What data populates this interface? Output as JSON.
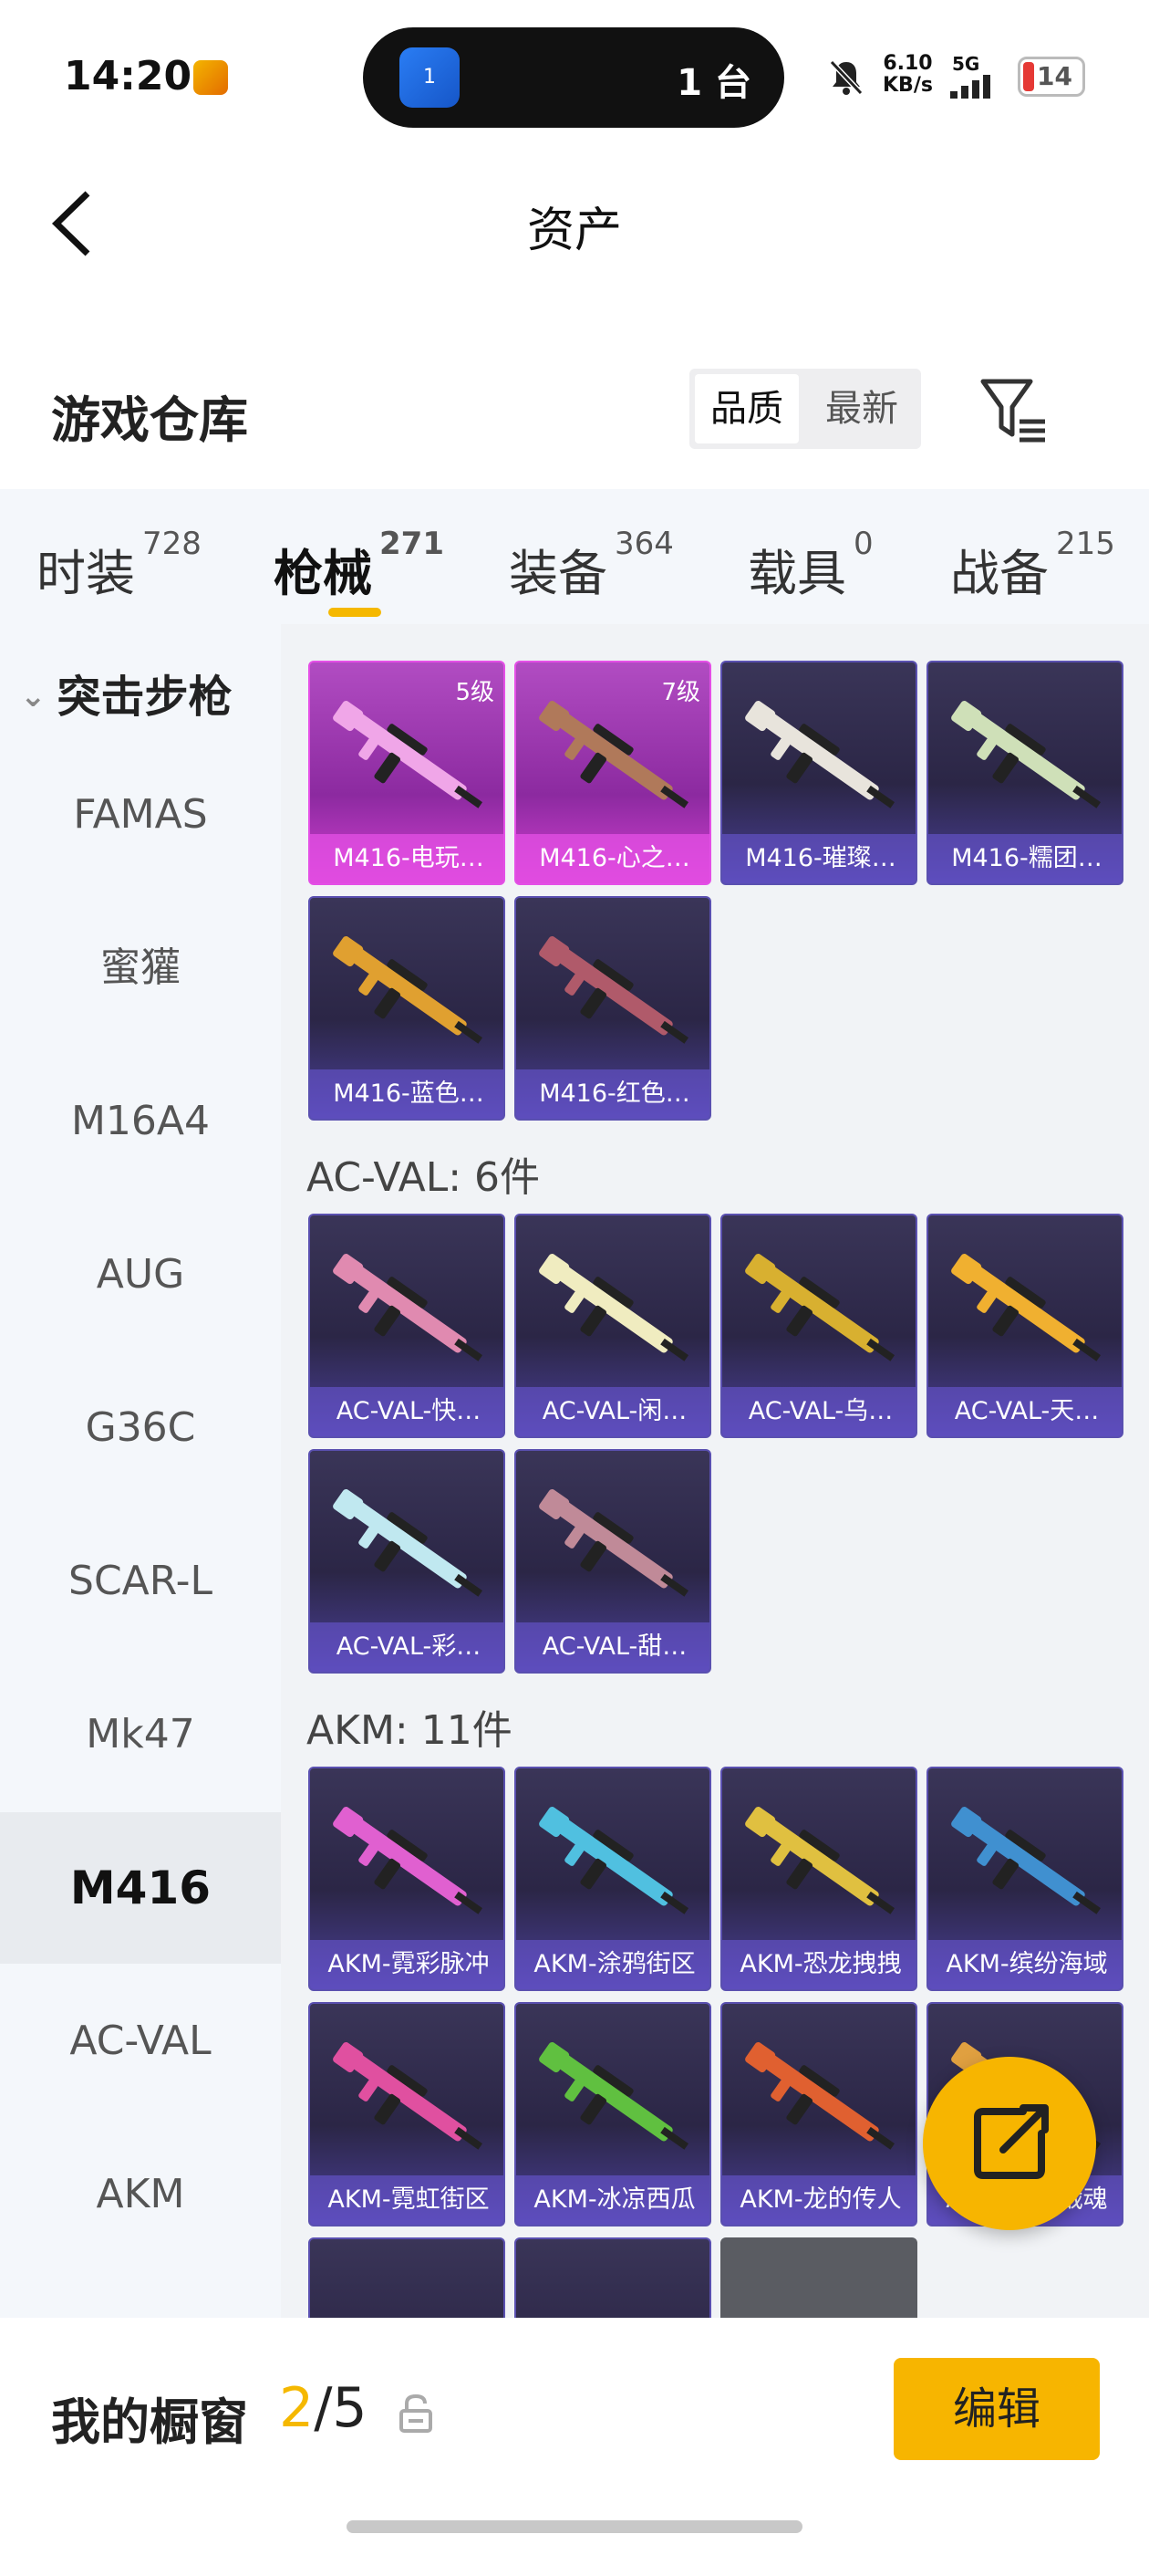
{
  "status_bar": {
    "time": "14:20",
    "island_badge": "1",
    "island_text": "1 台",
    "net_speed_value": "6.10",
    "net_speed_unit": "KB/s",
    "network_type": "5G",
    "battery": "14",
    "icons": [
      "app-icon",
      "broadcast-icon",
      "mute-icon",
      "signal-icon",
      "battery-icon"
    ]
  },
  "header": {
    "title": "资产",
    "back_icon": "chevron-left-icon"
  },
  "warehouse": {
    "title": "游戏仓库",
    "sort_options": [
      "品质",
      "最新"
    ],
    "sort_selected": "品质",
    "filter_icon": "filter-icon"
  },
  "tabs": [
    {
      "label": "时装",
      "count": "728"
    },
    {
      "label": "枪械",
      "count": "271",
      "active": true
    },
    {
      "label": "装备",
      "count": "364"
    },
    {
      "label": "载具",
      "count": "0"
    },
    {
      "label": "战备",
      "count": "215"
    }
  ],
  "sidebar": {
    "group": "突击步枪",
    "items": [
      "FAMAS",
      "蜜獾",
      "M16A4",
      "AUG",
      "G36C",
      "SCAR-L",
      "Mk47",
      "M416",
      "AC-VAL",
      "AKM"
    ],
    "selected": "M416"
  },
  "grid": {
    "groups": [
      {
        "heading": "",
        "cards": [
          {
            "name": "M416-电玩…",
            "level": "5级",
            "tier": "pink",
            "gun_color": "#f0a6e8"
          },
          {
            "name": "M416-心之…",
            "level": "7级",
            "tier": "pink",
            "gun_color": "#b0795a"
          },
          {
            "name": "M416-璀璨…",
            "level": "",
            "tier": "purple",
            "gun_color": "#e8e4dc"
          },
          {
            "name": "M416-糯团…",
            "level": "",
            "tier": "purple",
            "gun_color": "#cfe0b8"
          },
          {
            "name": "M416-蓝色…",
            "level": "",
            "tier": "purple",
            "gun_color": "#e0a030"
          },
          {
            "name": "M416-红色…",
            "level": "",
            "tier": "purple",
            "gun_color": "#b05a6a"
          }
        ]
      },
      {
        "heading": "AC-VAL: 6件",
        "cards": [
          {
            "name": "AC-VAL-快…",
            "level": "",
            "tier": "purple",
            "gun_color": "#e08ab0"
          },
          {
            "name": "AC-VAL-闲…",
            "level": "",
            "tier": "purple",
            "gun_color": "#f0ecc0"
          },
          {
            "name": "AC-VAL-乌…",
            "level": "",
            "tier": "purple",
            "gun_color": "#d8b030"
          },
          {
            "name": "AC-VAL-天…",
            "level": "",
            "tier": "purple",
            "gun_color": "#f0b030"
          },
          {
            "name": "AC-VAL-彩…",
            "level": "",
            "tier": "purple",
            "gun_color": "#c0e8f0"
          },
          {
            "name": "AC-VAL-甜…",
            "level": "",
            "tier": "purple",
            "gun_color": "#c08a98"
          }
        ]
      },
      {
        "heading": "AKM: 11件",
        "cards": [
          {
            "name": "AKM-霓彩脉冲",
            "level": "",
            "tier": "purple",
            "gun_color": "#e060d0"
          },
          {
            "name": "AKM-涂鸦街区",
            "level": "",
            "tier": "purple",
            "gun_color": "#50c0e0"
          },
          {
            "name": "AKM-恐龙拽拽",
            "level": "",
            "tier": "purple",
            "gun_color": "#e0c040"
          },
          {
            "name": "AKM-缤纷海域",
            "level": "",
            "tier": "purple",
            "gun_color": "#4090d0"
          },
          {
            "name": "AKM-霓虹街区",
            "level": "",
            "tier": "purple",
            "gun_color": "#e050a0"
          },
          {
            "name": "AKM-冰凉西瓜",
            "level": "",
            "tier": "purple",
            "gun_color": "#60c040"
          },
          {
            "name": "AKM-龙的传人",
            "level": "",
            "tier": "purple",
            "gun_color": "#e06030"
          },
          {
            "name": "AKM-破晓战魂",
            "level": "",
            "tier": "purple",
            "gun_color": "#e0a040"
          }
        ]
      }
    ]
  },
  "fab_icon": "share-out-icon",
  "showcase": {
    "label": "我的橱窗",
    "current": "2",
    "separator": "/",
    "max": "5",
    "lock_icon": "lock-icon"
  },
  "edit_label": "编辑",
  "colors": {
    "accent": "#f7b500",
    "card_purple": "#3a3558",
    "card_pink": "#b14cc2"
  }
}
